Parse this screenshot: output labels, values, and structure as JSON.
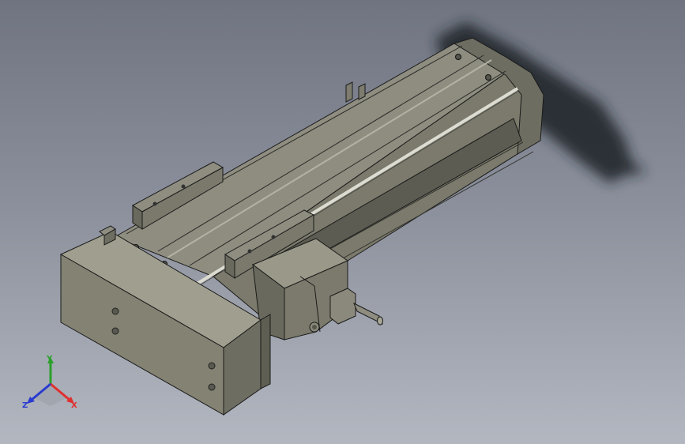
{
  "viewport": {
    "background_top": "#6f7480",
    "background_bottom": "#b3b7c0"
  },
  "model": {
    "body_color": "#8d8c7e",
    "body_dark": "#5e5d52",
    "body_light": "#a8a797",
    "edge_color": "#1a1a1a",
    "shadow_color": "#202226"
  },
  "triad": {
    "x_label": "X",
    "y_label": "Y",
    "z_label": "Z",
    "x_color": "#e03030",
    "y_color": "#2aa02a",
    "z_color": "#2a3ad0"
  }
}
